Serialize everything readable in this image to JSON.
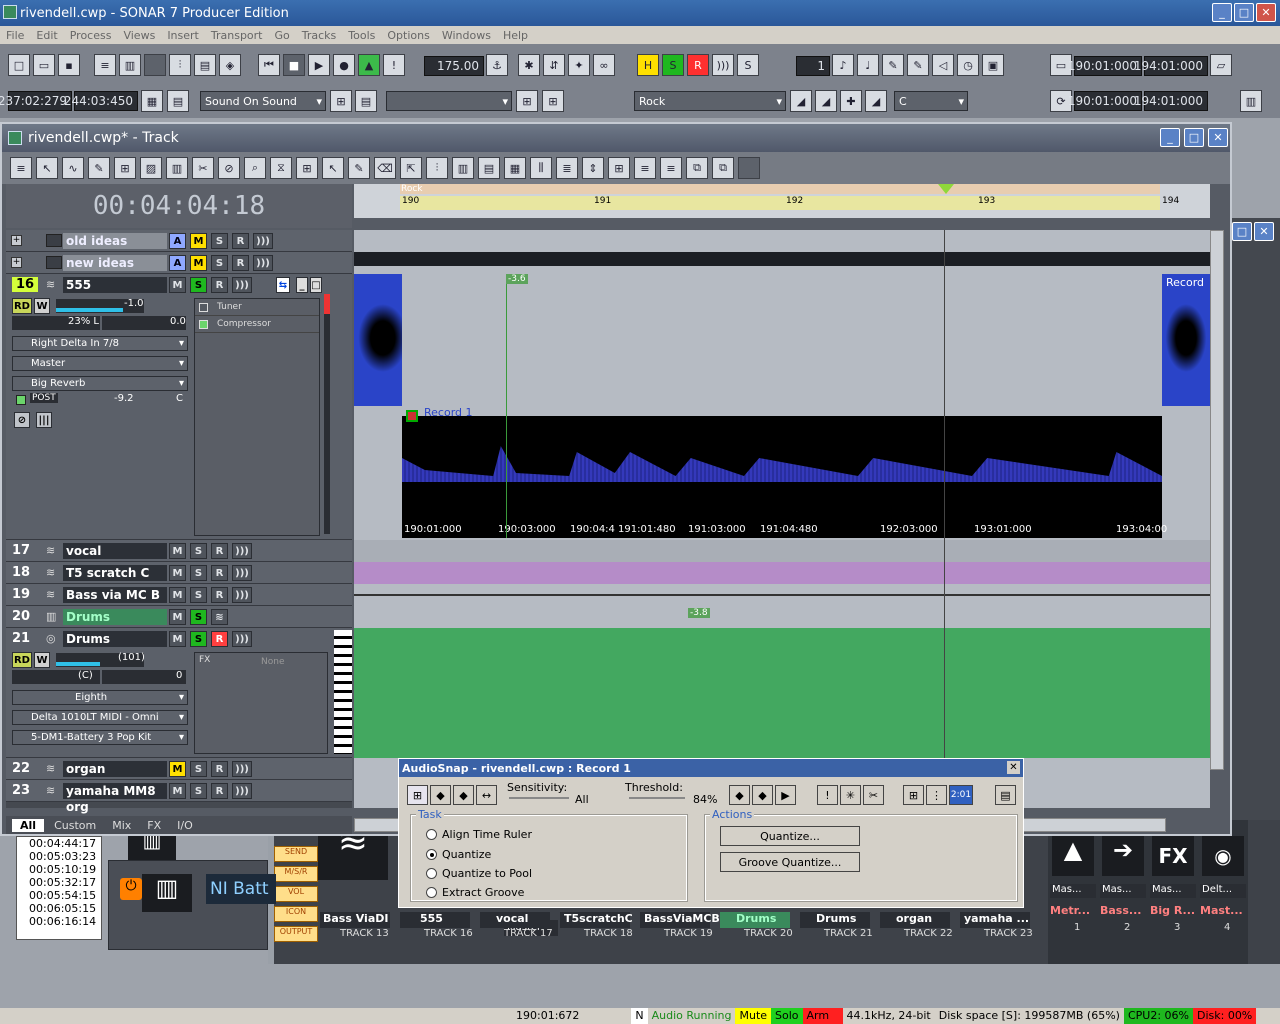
{
  "app": {
    "title": "rivendell.cwp - SONAR 7 Producer Edition"
  },
  "menu": [
    "File",
    "Edit",
    "Process",
    "Views",
    "Insert",
    "Transport",
    "Go",
    "Tracks",
    "Tools",
    "Options",
    "Windows",
    "Help"
  ],
  "toolbar": {
    "tempo": "175.00",
    "midi_channel": "1",
    "loop_start": "190:01:000",
    "loop_end": "194:01:000",
    "sel_start": "237:02:279",
    "sel_end": "244:03:450",
    "sound_on_sound": "Sound On Sound",
    "marker_preset": "Rock",
    "key": "C",
    "punch_start": "190:01:000",
    "punch_end": "194:01:000"
  },
  "track_view": {
    "title": "rivendell.cwp* - Track",
    "time": "00:04:04:18",
    "ruler": {
      "marker": "Rock",
      "bars": [
        "190",
        "191",
        "192",
        "193",
        "194"
      ]
    },
    "folders": [
      {
        "name": "old ideas"
      },
      {
        "name": "new ideas"
      }
    ],
    "tracks": [
      {
        "num": "16",
        "name": "555",
        "vol": "-1.0",
        "pan": "23% L",
        "trim": "0.0",
        "input": "Right Delta In 7/8",
        "output": "Master",
        "send": "Big Reverb",
        "send_mode": "POST",
        "send_level": "-9.2",
        "send_pan": "C",
        "fx": [
          "Tuner",
          "Compressor"
        ]
      },
      {
        "num": "17",
        "name": "vocal"
      },
      {
        "num": "18",
        "name": "T5 scratch C"
      },
      {
        "num": "19",
        "name": "Bass via MC B"
      },
      {
        "num": "20",
        "name": "Drums"
      },
      {
        "num": "21",
        "name": "Drums",
        "vol": "(101)",
        "pan": "(C)",
        "trim": "0",
        "fx_label": "FX",
        "fx_none": "None",
        "quantize": "Eighth",
        "input": "Delta 1010LT MIDI - Omni",
        "output": "5-DM1-Battery 3 Pop Kit"
      },
      {
        "num": "22",
        "name": "organ"
      },
      {
        "num": "23",
        "name": "yamaha MM8 org"
      }
    ],
    "clip_labels": {
      "record_a": "Record",
      "record_1": "Record 1",
      "marker_a": "-3.6",
      "marker_b": "-3.8"
    },
    "beat_times": [
      "190:01:000",
      "190:03:000",
      "190:04:4",
      "191:01:480",
      "191:03:000",
      "191:04:480",
      "192:03:000",
      "193:01:000",
      "193:04:00"
    ],
    "bottom_tabs": [
      "All",
      "Custom",
      "Mix",
      "FX",
      "I/O"
    ]
  },
  "audiosnap": {
    "title": "AudioSnap - rivendell.cwp : Record 1",
    "sensitivity_label": "Sensitivity:",
    "sensitivity_value": "All",
    "threshold_label": "Threshold:",
    "threshold_value": "84%",
    "threshold_level": 0.84,
    "task_label": "Task",
    "tasks": [
      "Align Time Ruler",
      "Quantize",
      "Quantize to Pool",
      "Extract Groove"
    ],
    "selected_task": "Quantize",
    "actions_label": "Actions",
    "quantize_btn": "Quantize...",
    "groove_btn": "Groove Quantize...",
    "time_display": "2:01"
  },
  "console": {
    "list_times": [
      "00:04:44:17",
      "00:05:03:23",
      "00:05:10:19",
      "00:05:32:17",
      "00:05:54:15",
      "00:06:05:15",
      "00:06:16:14"
    ],
    "synth_label": "NI Batt",
    "side_buttons": [
      "SEND",
      "M/S/R",
      "VOL",
      "ICON",
      "OUTPUT"
    ],
    "master_out": "Master",
    "strips": [
      {
        "name": "Bass ViaDI",
        "track": "TRACK 13"
      },
      {
        "name": "555",
        "track": "TRACK 16"
      },
      {
        "name": "vocal",
        "track": "TRACK 17"
      },
      {
        "name": "T5scratchC",
        "track": "TRACK 18"
      },
      {
        "name": "BassViaMCB",
        "track": "TRACK 19"
      },
      {
        "name": "Drums",
        "track": "TRACK 20"
      },
      {
        "name": "Drums",
        "track": "TRACK 21"
      },
      {
        "name": "organ",
        "track": "TRACK 22"
      },
      {
        "name": "yamaha ...",
        "track": "TRACK 23"
      }
    ],
    "bus_strips": [
      {
        "out": "Mas...",
        "name": "Metr...",
        "num": "1"
      },
      {
        "out": "Mas...",
        "name": "Bass...",
        "num": "2"
      },
      {
        "out": "Mas...",
        "name": "Big R...",
        "num": "3"
      },
      {
        "out": "Delt...",
        "name": "Mast...",
        "num": "4"
      }
    ]
  },
  "status": {
    "position": "190:01:672",
    "flag": "N",
    "audio": "Audio Running",
    "mute": "Mute",
    "solo": "Solo",
    "arm": "Arm",
    "rate": "44.1kHz, 24-bit",
    "disk": "Disk space [S]: 199587MB (65%)",
    "cpu": "CPU2: 06%",
    "diskload": "Disk: 00%"
  },
  "colors": {
    "audio_wave": "#3a3fd0",
    "midi_clip": "#43a860",
    "purple_clip": "#b58cc8",
    "track_green_name": "#3a8a5c"
  }
}
